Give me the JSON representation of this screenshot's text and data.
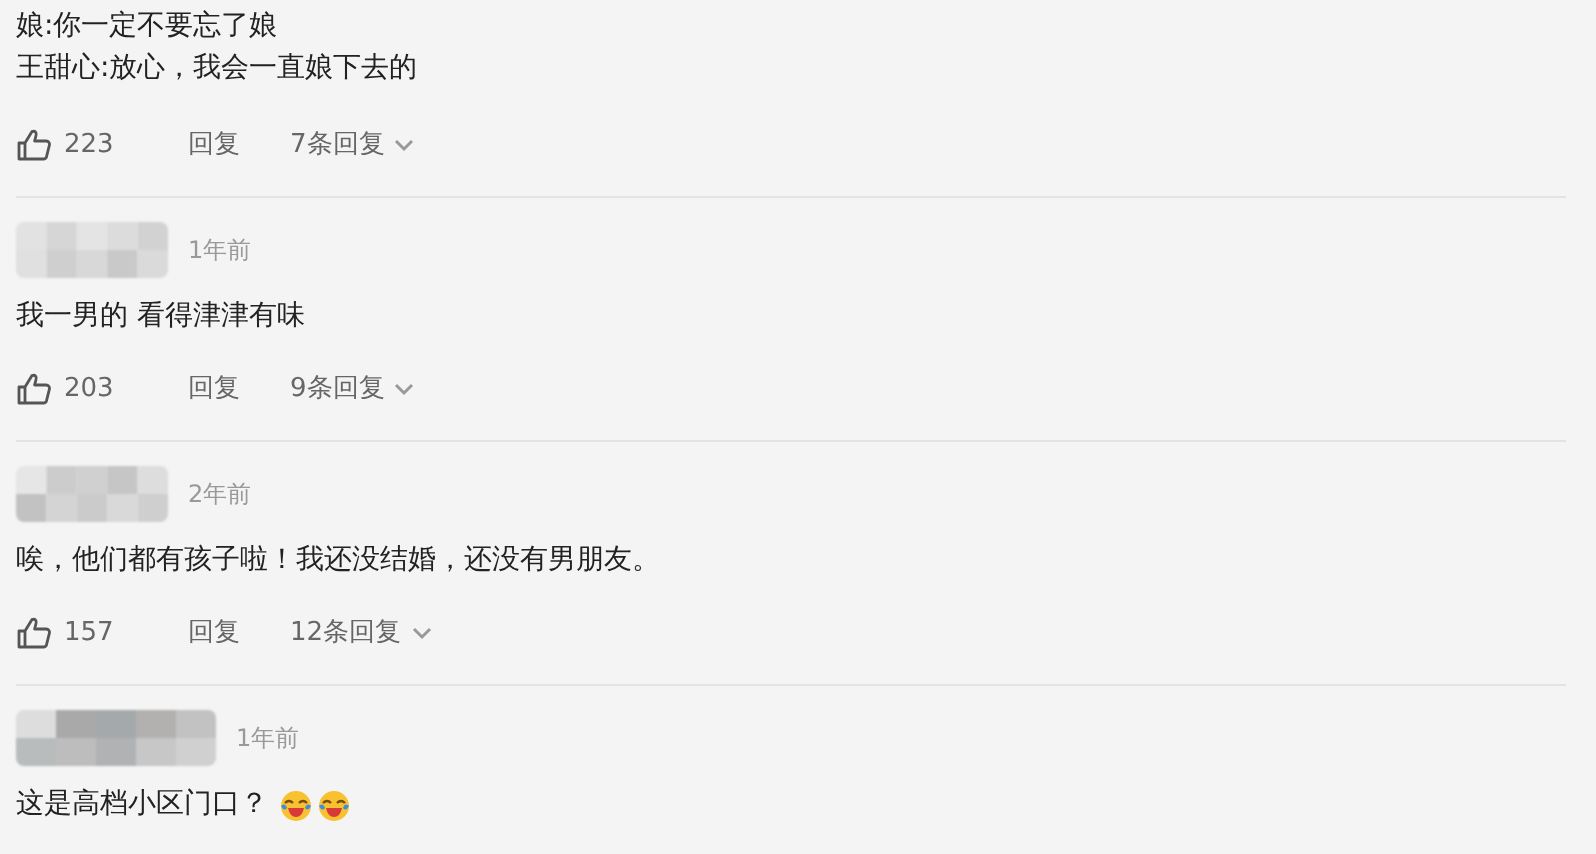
{
  "comments": [
    {
      "lines": [
        "娘:你一定不要忘了娘",
        "王甜心:放心，我会一直娘下去的"
      ],
      "likes": "223",
      "reply": "回复",
      "replies": "7条回复"
    },
    {
      "time": "1年前",
      "lines": [
        "我一男的 看得津津有味"
      ],
      "likes": "203",
      "reply": "回复",
      "replies": "9条回复"
    },
    {
      "time": "2年前",
      "lines": [
        "唉，他们都有孩子啦！我还没结婚，还没有男朋友。"
      ],
      "likes": "157",
      "reply": "回复",
      "replies": "12条回复"
    },
    {
      "time": "1年前",
      "lines": [
        "这是高档小区门口？"
      ],
      "emojis": [
        {
          "kind": "laugh-cry"
        },
        {
          "kind": "laugh-cry"
        }
      ]
    }
  ]
}
